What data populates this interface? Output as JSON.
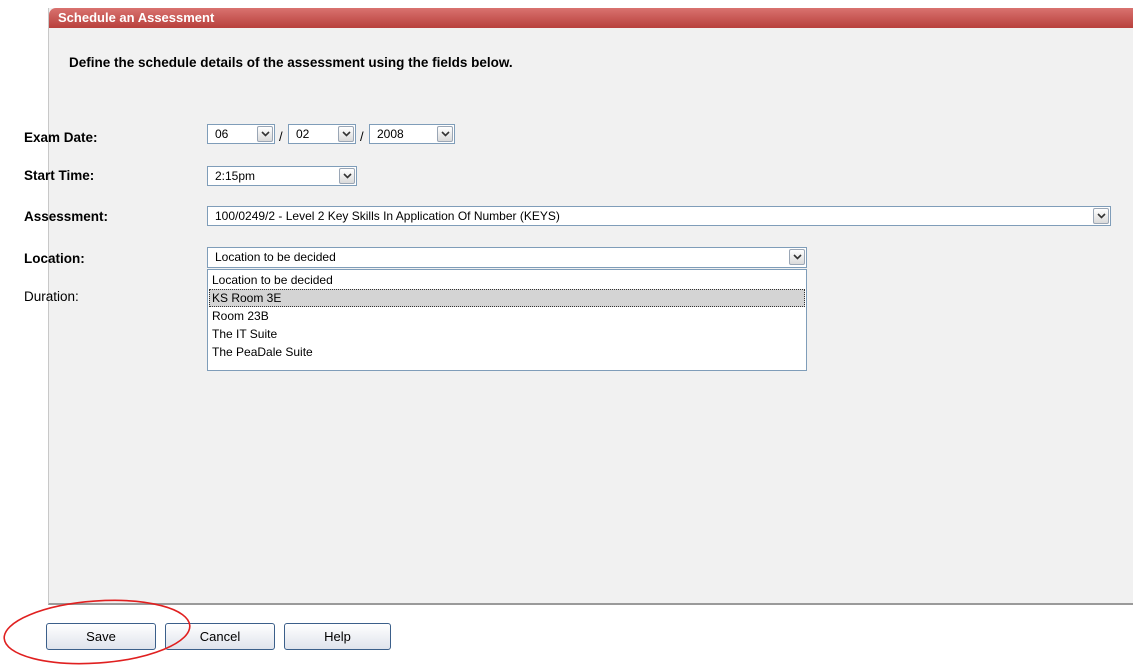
{
  "header": {
    "title": "Schedule an Assessment"
  },
  "intro": "Define the schedule details of the assessment using the fields below.",
  "exam_date": {
    "label": "Exam Date:",
    "day": "06",
    "month": "02",
    "year": "2008",
    "separator": "/"
  },
  "start_time": {
    "label": "Start Time:",
    "value": "2:15pm"
  },
  "assessment": {
    "label": "Assessment:",
    "value": "100/0249/2 - Level 2 Key Skills In Application Of Number (KEYS)"
  },
  "location": {
    "label": "Location:",
    "value": "Location to be decided",
    "options": [
      "Location to be decided",
      "KS Room 3E",
      "Room 23B",
      "The IT Suite",
      "The PeaDale Suite"
    ],
    "highlighted_option": "KS Room 3E"
  },
  "duration": {
    "label": "Duration:"
  },
  "buttons": {
    "save": "Save",
    "cancel": "Cancel",
    "help": "Help"
  },
  "icons": {
    "dropdown": "chevron-down-icon",
    "annotation": "red-ellipse-highlight"
  },
  "colors": {
    "header": "#c0504d",
    "annotation": "#e02020",
    "panel": "#f1f1f1"
  }
}
